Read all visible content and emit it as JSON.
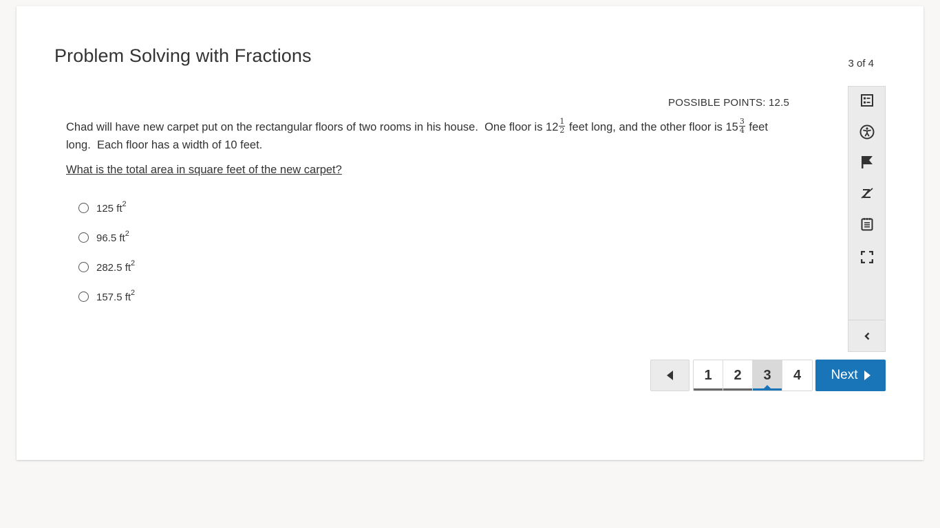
{
  "header": {
    "title": "Problem Solving with Fractions",
    "counter": "3 of 4"
  },
  "question": {
    "possible_points": "POSSIBLE POINTS: 12.5",
    "stem": {
      "part1": "Chad will have new carpet put on the rectangular floors of two rooms in his house.  One floor is 12",
      "frac1_num": "1",
      "frac1_den": "2",
      "part2": " feet long, and the other floor is 15",
      "frac2_num": "3",
      "frac2_den": "4",
      "part3": " feet long.  Each floor has a width of 10 feet."
    },
    "prompt": "What is the total area in square feet of the new carpet?",
    "choices": [
      {
        "value": "125 ft",
        "exp": "2",
        "selected": false
      },
      {
        "value": "96.5 ft",
        "exp": "2",
        "selected": false
      },
      {
        "value": "282.5 ft",
        "exp": "2",
        "selected": false
      },
      {
        "value": "157.5 ft",
        "exp": "2",
        "selected": false
      }
    ]
  },
  "toolbar": {
    "tools": [
      {
        "name": "item-overview",
        "icon": "list-icon"
      },
      {
        "name": "accessibility",
        "icon": "accessibility-icon"
      },
      {
        "name": "flag",
        "icon": "flag-icon"
      },
      {
        "name": "answer-eliminator",
        "icon": "eliminator-icon"
      },
      {
        "name": "notepad",
        "icon": "notepad-icon"
      },
      {
        "name": "fullscreen",
        "icon": "fullscreen-icon"
      }
    ],
    "collapse_icon": "chevron-left-icon"
  },
  "navigation": {
    "pages": [
      "1",
      "2",
      "3",
      "4"
    ],
    "current_page": "3",
    "visited_pages": [
      "1",
      "2"
    ],
    "next_label": "Next",
    "accent_color": "#1a75b8"
  }
}
